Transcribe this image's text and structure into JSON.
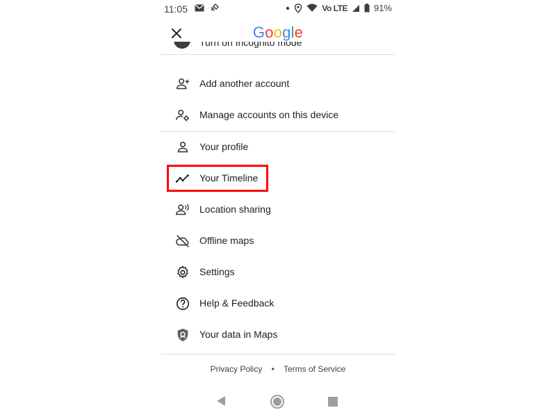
{
  "status_bar": {
    "time": "11:05",
    "network": "Vo LTE",
    "battery": "91%"
  },
  "header": {
    "logo_letters": [
      {
        "ch": "G",
        "color": "#4285F4"
      },
      {
        "ch": "o",
        "color": "#EA4335"
      },
      {
        "ch": "o",
        "color": "#FBBC05"
      },
      {
        "ch": "g",
        "color": "#4285F4"
      },
      {
        "ch": "l",
        "color": "#34A853"
      },
      {
        "ch": "e",
        "color": "#EA4335"
      }
    ]
  },
  "menu": {
    "partial_label": "Turn on Incognito mode",
    "items": [
      {
        "label": "Add another account",
        "icon": "add-person-icon"
      },
      {
        "label": "Manage accounts on this device",
        "icon": "manage-accounts-icon"
      },
      {
        "label": "Your profile",
        "icon": "person-icon"
      },
      {
        "label": "Your Timeline",
        "icon": "timeline-icon",
        "highlighted": true
      },
      {
        "label": "Location sharing",
        "icon": "location-sharing-icon"
      },
      {
        "label": "Offline maps",
        "icon": "cloud-off-icon"
      },
      {
        "label": "Settings",
        "icon": "gear-icon"
      },
      {
        "label": "Help & Feedback",
        "icon": "help-icon"
      },
      {
        "label": "Your data in Maps",
        "icon": "shield-icon"
      }
    ]
  },
  "footer": {
    "privacy": "Privacy Policy",
    "separator": "•",
    "terms": "Terms of Service"
  },
  "colors": {
    "highlight": "#ff0000",
    "divider": "#dadce0"
  }
}
